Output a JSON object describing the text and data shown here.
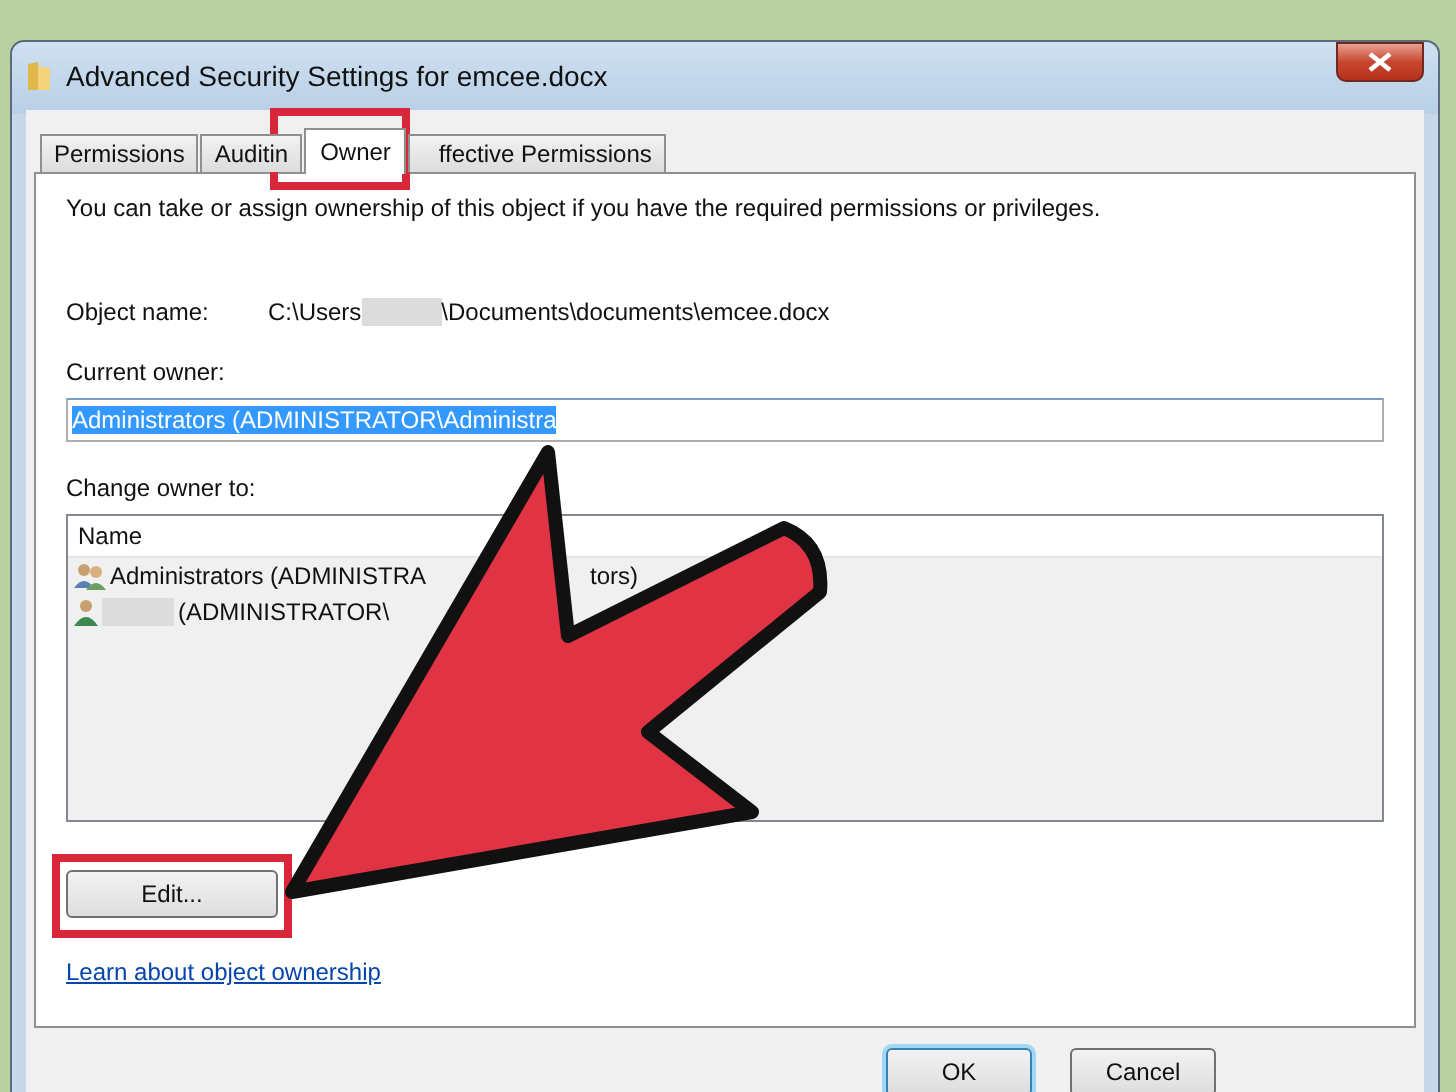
{
  "window": {
    "title": "Advanced Security Settings for emcee.docx"
  },
  "tabs": [
    {
      "label": "Permissions",
      "selected": false
    },
    {
      "label": "Auditin",
      "selected": false
    },
    {
      "label": "Owner",
      "selected": true
    },
    {
      "label": "ffective Permissions",
      "selected": false
    }
  ],
  "intro": "You can take or assign ownership of this object if you have the required permissions or privileges.",
  "object_name": {
    "label": "Object name:",
    "path_start": "C:\\Users",
    "path_end": "\\Documents\\documents\\emcee.docx"
  },
  "current_owner": {
    "label": "Current owner:",
    "value": "Administrators (ADMINISTRATOR\\Administra",
    "text_selected": true
  },
  "change_owner": {
    "label": "Change owner to:",
    "column": "Name",
    "rows": [
      {
        "kind": "group",
        "parts": [
          "Administrators (ADMINISTRA",
          "tors)"
        ]
      },
      {
        "kind": "user",
        "parts": [
          "(ADMINISTRATOR\\"
        ]
      }
    ]
  },
  "edit_button": "Edit...",
  "link": "Learn about object ownership",
  "buttons": [
    {
      "label": "OK",
      "default": true
    },
    {
      "label": "Cancel",
      "default": false
    }
  ]
}
